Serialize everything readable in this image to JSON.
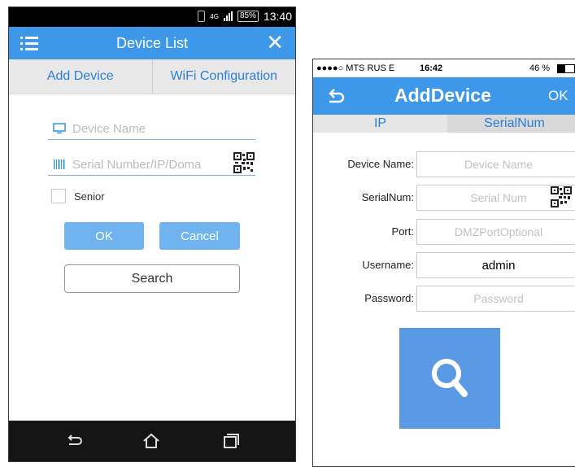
{
  "android": {
    "status": {
      "battery": "85%",
      "time": "13:40",
      "network": "4G"
    },
    "header": {
      "title": "Device List"
    },
    "tabs": [
      "Add Device",
      "WiFi Configuration"
    ],
    "device_name_placeholder": "Device Name",
    "serial_placeholder": "Serial Number/IP/Doma",
    "senior_label": "Senior",
    "ok_label": "OK",
    "cancel_label": "Cancel",
    "search_label": "Search",
    "colors": {
      "accent": "#3d98ea",
      "button": "#6fb3f0",
      "tab_text": "#2b7fd4"
    }
  },
  "ios": {
    "status": {
      "carrier": "●●●●○ MTS RUS  E",
      "time": "16:42",
      "battery": "46 %"
    },
    "header": {
      "title": "AddDevice",
      "ok": "OK"
    },
    "tabs": [
      "IP",
      "SerialNum"
    ],
    "fields": [
      {
        "label": "Device Name:",
        "placeholder": "Device Name",
        "value": ""
      },
      {
        "label": "SerialNum:",
        "placeholder": "Serial Num",
        "value": ""
      },
      {
        "label": "Port:",
        "placeholder": "DMZPortOptional",
        "value": ""
      },
      {
        "label": "Username:",
        "placeholder": "",
        "value": "admin"
      },
      {
        "label": "Password:",
        "placeholder": "Password",
        "value": ""
      }
    ],
    "colors": {
      "accent": "#3d98ea",
      "search_button": "#5a9ae5"
    }
  },
  "icons": [
    "hamburger-menu-icon",
    "close-icon",
    "monitor-icon",
    "barcode-icon",
    "qr-code-icon",
    "back-icon",
    "home-icon",
    "recent-apps-icon",
    "magnifier-icon"
  ]
}
